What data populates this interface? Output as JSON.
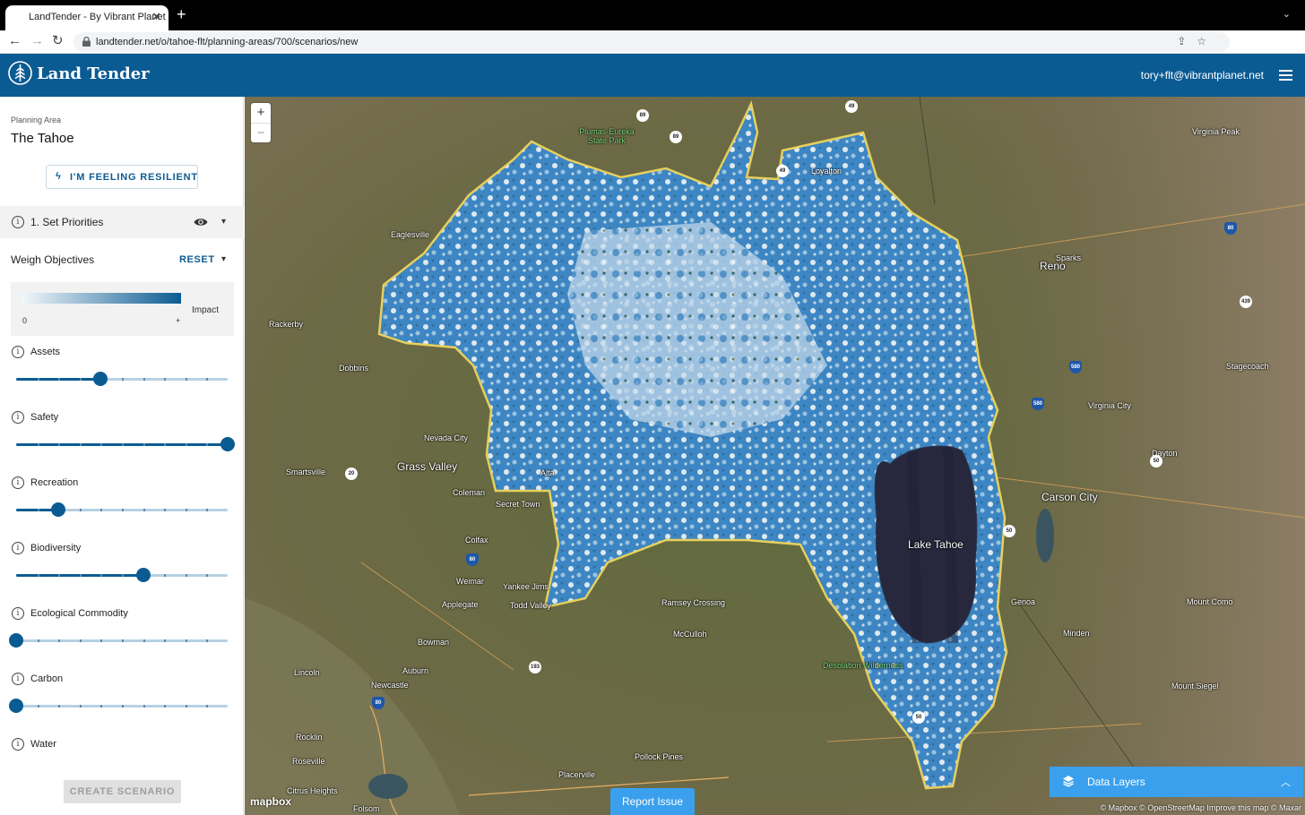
{
  "browser": {
    "tab_title": "LandTender - By Vibrant Planet",
    "url": "landtender.net/o/tahoe-flt/planning-areas/700/scenarios/new",
    "profile_initial": "T"
  },
  "header": {
    "logo": "Land Tender",
    "user_email": "tory+flt@vibrantplanet.net"
  },
  "sidebar": {
    "planning_area_label": "Planning Area",
    "planning_area_name": "The Tahoe",
    "resilient_button": "I'M FEELING RESILIENT",
    "step_label": "1. Set Priorities",
    "weigh_label": "Weigh Objectives",
    "reset_label": "RESET",
    "legend": {
      "min": "0",
      "max": "+",
      "label": "Impact"
    },
    "objectives": [
      {
        "label": "Assets",
        "value": 0.4
      },
      {
        "label": "Safety",
        "value": 1.0
      },
      {
        "label": "Recreation",
        "value": 0.2
      },
      {
        "label": "Biodiversity",
        "value": 0.6
      },
      {
        "label": "Ecological Commodity",
        "value": 0.0
      },
      {
        "label": "Carbon",
        "value": 0.0
      },
      {
        "label": "Water",
        "value": null
      }
    ],
    "create_button": "CREATE SCENARIO"
  },
  "map": {
    "zoom_in": "+",
    "zoom_out": "−",
    "labels": [
      "Plumas-Eureka State Park",
      "Loyalton",
      "Reno",
      "Sparks",
      "Virginia City",
      "Carson City",
      "Lake Tahoe",
      "Nevada City",
      "Grass Valley",
      "Auburn",
      "Placerville",
      "Roseville",
      "Rocklin",
      "Lincoln",
      "Citrus Heights",
      "Folsom",
      "Colfax",
      "Desolation Wilderness",
      "Minden",
      "Genoa",
      "Dayton",
      "Stagecoach",
      "Virginia Peak",
      "Mount Como",
      "Mount Siegel",
      "Smartsville",
      "Rackerby",
      "Dobbins",
      "Newcastle",
      "Pollock Pines",
      "Eaglesville",
      "Secret Town",
      "Weimar",
      "Applegate",
      "Yankee Jims",
      "Todd Valley",
      "Ramsey Crossing",
      "McCulloh",
      "Bowman",
      "Coleman",
      "Alta"
    ],
    "mapbox_logo": "mapbox",
    "attribution": "© Mapbox © OpenStreetMap Improve this map © Maxar",
    "report_button": "Report Issue",
    "data_layers": "Data Layers"
  }
}
